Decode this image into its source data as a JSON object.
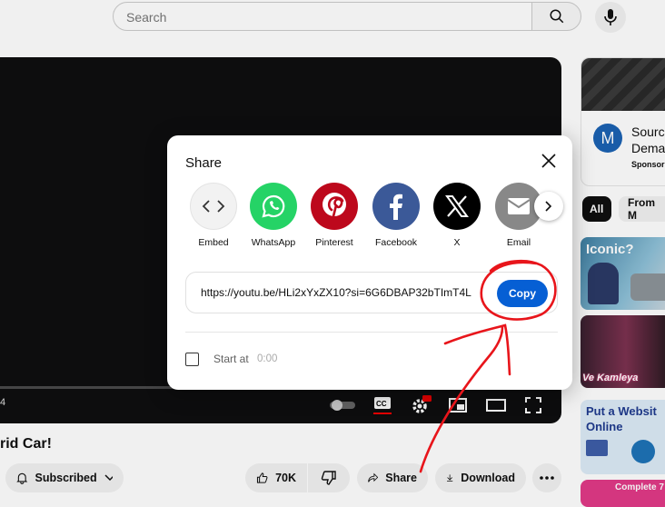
{
  "search": {
    "placeholder": "Search"
  },
  "video": {
    "time_fragment": "4",
    "title_fragment": "rid Car!",
    "subscribed_label": "Subscribed",
    "likes": "70K",
    "share_label": "Share",
    "download_label": "Download"
  },
  "sidebar": {
    "ad": {
      "logo_letter": "M",
      "line1": "Sourci",
      "line2": "Dema",
      "sponsored": "Sponsor"
    },
    "chips": [
      "All",
      "From M"
    ],
    "thumbs": [
      {
        "text": "Iconic?"
      },
      {
        "text": "Ve Kamleya"
      },
      {
        "text": "Put a Websit Online"
      },
      {
        "text": "Complete 7"
      }
    ]
  },
  "share_dialog": {
    "title": "Share",
    "targets": [
      {
        "label": "Embed",
        "icon": "embed-icon",
        "color": "#f2f2f2"
      },
      {
        "label": "WhatsApp",
        "icon": "whatsapp-icon",
        "color": "#25d366"
      },
      {
        "label": "Pinterest",
        "icon": "pinterest-icon",
        "color": "#bd081c"
      },
      {
        "label": "Facebook",
        "icon": "facebook-icon",
        "color": "#3b5998"
      },
      {
        "label": "X",
        "icon": "x-icon",
        "color": "#000000"
      },
      {
        "label": "Email",
        "icon": "email-icon",
        "color": "#888888"
      }
    ],
    "url": "https://youtu.be/HLi2xYxZX10?si=6G6DBAP32bTImT4L",
    "copy_label": "Copy",
    "start_at_label": "Start at",
    "start_at_time": "0:00"
  },
  "annotation_color": "#e8151b"
}
